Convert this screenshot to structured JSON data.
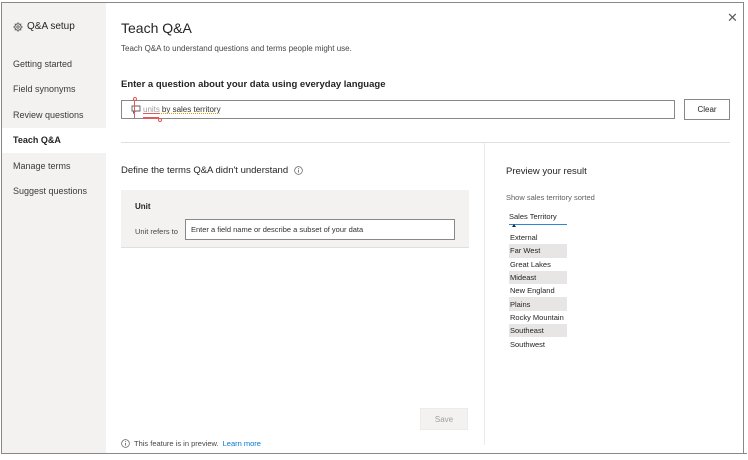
{
  "sidebar": {
    "title": "Q&A setup",
    "items": [
      {
        "label": "Getting started",
        "active": false
      },
      {
        "label": "Field synonyms",
        "active": false
      },
      {
        "label": "Review questions",
        "active": false
      },
      {
        "label": "Teach Q&A",
        "active": true
      },
      {
        "label": "Manage terms",
        "active": false
      },
      {
        "label": "Suggest questions",
        "active": false
      }
    ]
  },
  "header": {
    "title": "Teach Q&A",
    "subtitle": "Teach Q&A to understand questions and terms people might use."
  },
  "question": {
    "label": "Enter a question about your data using everyday language",
    "unrecognized_term": "units",
    "recognized_text": "by sales territory",
    "clear_label": "Clear"
  },
  "define": {
    "label": "Define the terms Q&A didn't understand",
    "term": "Unit",
    "refers_label": "Unit refers to",
    "field_placeholder": "Enter a field name or describe a subset of your data",
    "save_label": "Save"
  },
  "preview": {
    "title": "Preview your result",
    "description": "Show sales territory sorted",
    "column_header": "Sales Territory",
    "rows": [
      "External",
      "Far West",
      "Great Lakes",
      "Mideast",
      "New England",
      "Plains",
      "Rocky Mountain",
      "Southeast",
      "Southwest"
    ]
  },
  "footer": {
    "note": "This feature is in preview.",
    "link": "Learn more"
  },
  "colors": {
    "sidebar_bg": "#f3f2f1",
    "accent_error": "#e05a5a",
    "link": "#0078d4"
  }
}
